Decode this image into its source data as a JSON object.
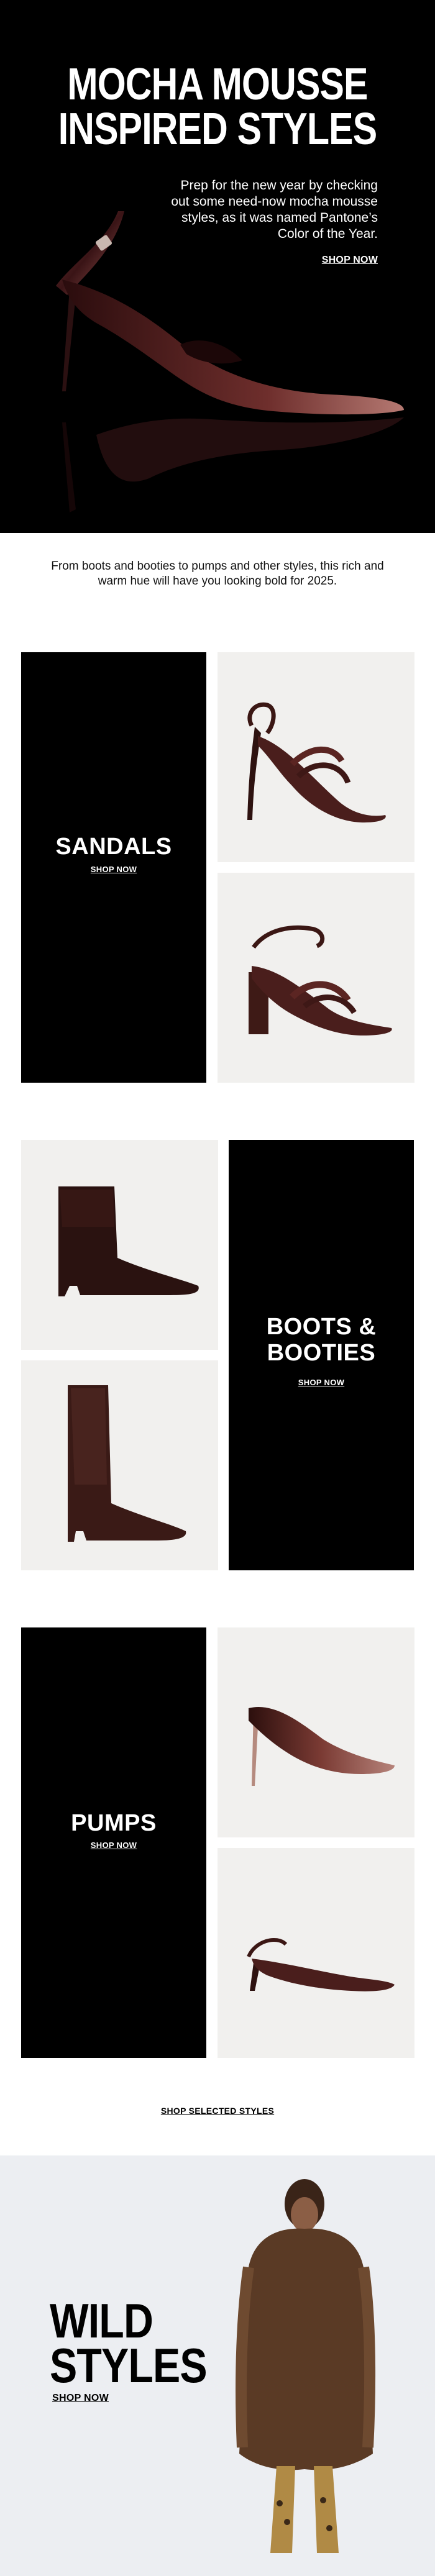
{
  "hero": {
    "title_line1": "MOCHA MOUSSE",
    "title_line2": "INSPIRED STYLES",
    "copy": "Prep for the new year by checking out some need-now mocha mousse styles, as it was named Pantone’s Color of the Year.",
    "shop_label": "SHOP NOW",
    "image_icon": "metallic-slingback-pump-image"
  },
  "intro": {
    "text": "From boots and booties to pumps and other styles, this rich and warm hue will have you looking bold for 2025."
  },
  "sections": [
    {
      "title": "SANDALS",
      "shop_label": "SHOP NOW",
      "images": [
        "slingback-sandal-image",
        "block-heel-sandal-image"
      ]
    },
    {
      "title_line1": "BOOTS &",
      "title_line2": "BOOTIES",
      "shop_label": "SHOP NOW",
      "images": [
        "ankle-bootie-image",
        "knee-high-boot-image"
      ]
    },
    {
      "title": "PUMPS",
      "shop_label": "SHOP NOW",
      "images": [
        "metallic-pump-image",
        "kitten-heel-slingback-image"
      ]
    }
  ],
  "shop_selected_label": "SHOP SELECTED STYLES",
  "wild": {
    "title_line1": "WILD",
    "title_line2": "STYLES",
    "shop_label": "SHOP NOW",
    "image_icon": "model-in-fur-coat-image"
  },
  "colors": {
    "background": "#ffffff",
    "panel": "#000000",
    "tile": "#f1f0ee",
    "mocha": "#4a1e1c",
    "wild_bg": "#eceef2"
  }
}
